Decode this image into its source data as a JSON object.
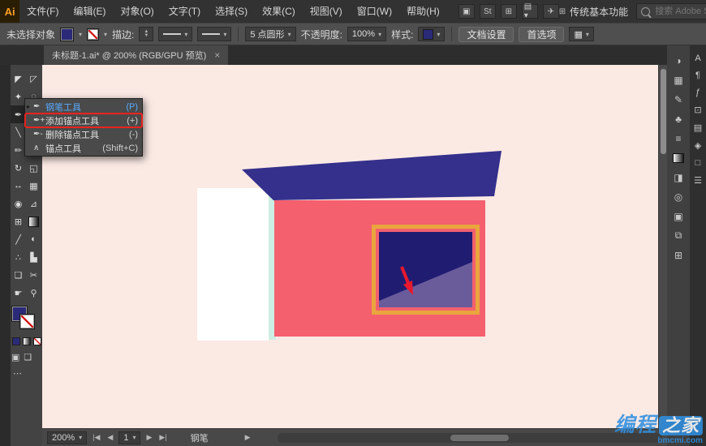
{
  "app": {
    "logo": "Ai"
  },
  "menubar": {
    "items": [
      {
        "name": "file",
        "label": "文件(F)"
      },
      {
        "name": "edit",
        "label": "编辑(E)"
      },
      {
        "name": "object",
        "label": "对象(O)"
      },
      {
        "name": "type",
        "label": "文字(T)"
      },
      {
        "name": "select",
        "label": "选择(S)"
      },
      {
        "name": "effect",
        "label": "效果(C)"
      },
      {
        "name": "view",
        "label": "视图(V)"
      },
      {
        "name": "window",
        "label": "窗口(W)"
      },
      {
        "name": "help",
        "label": "帮助(H)"
      }
    ],
    "icons": [
      {
        "name": "document-arrange-icon",
        "glyph": "▣"
      },
      {
        "name": "stock-icon",
        "glyph": "St"
      },
      {
        "name": "grid-view-icon",
        "glyph": "⊞"
      },
      {
        "name": "workspace-layout-icon",
        "glyph": "▤ ▾"
      },
      {
        "name": "share-icon",
        "glyph": "✈"
      }
    ],
    "workspace": "传统基本功能",
    "search_placeholder": "搜索 Adobe Stock"
  },
  "controlbar": {
    "selection_status": "未选择对象",
    "stroke_label": "描边:",
    "brush_name": "5 点圆形",
    "opacity_label": "不透明度:",
    "opacity_value": "100%",
    "style_label": "样式:",
    "doc_setup_label": "文档设置",
    "preferences_label": "首选项"
  },
  "tab": {
    "title": "未标题-1.ai* @ 200% (RGB/GPU 预览)",
    "close": "×"
  },
  "toolbar": {
    "tools": [
      {
        "name": "selection-tool",
        "glyph": "◤"
      },
      {
        "name": "direct-selection-tool",
        "glyph": "◸"
      },
      {
        "name": "magic-wand-tool",
        "glyph": "✦"
      },
      {
        "name": "lasso-tool",
        "glyph": "◌"
      },
      {
        "name": "pen-tool",
        "glyph": "✒",
        "active": true
      },
      {
        "name": "type-tool",
        "glyph": "T"
      },
      {
        "name": "line-segment-tool",
        "glyph": "╲"
      },
      {
        "name": "rectangle-tool",
        "glyph": "▭"
      },
      {
        "name": "paintbrush-tool",
        "glyph": "✏"
      },
      {
        "name": "pencil-tool",
        "glyph": "✎"
      },
      {
        "name": "rotate-tool",
        "glyph": "↻"
      },
      {
        "name": "scale-tool",
        "glyph": "◱"
      },
      {
        "name": "width-tool",
        "glyph": "↔"
      },
      {
        "name": "free-transform-tool",
        "glyph": "▦"
      },
      {
        "name": "shape-builder-tool",
        "glyph": "◉"
      },
      {
        "name": "perspective-grid-tool",
        "glyph": "⊿"
      },
      {
        "name": "mesh-tool",
        "glyph": "⊞"
      },
      {
        "name": "gradient-tool",
        "kind": "gradient"
      },
      {
        "name": "eyedropper-tool",
        "glyph": "╱"
      },
      {
        "name": "blend-tool",
        "glyph": "◐"
      },
      {
        "name": "symbol-sprayer-tool",
        "glyph": "∴"
      },
      {
        "name": "column-graph-tool",
        "glyph": "▙"
      },
      {
        "name": "artboard-tool",
        "glyph": "❏"
      },
      {
        "name": "slice-tool",
        "glyph": "✂"
      },
      {
        "name": "hand-tool",
        "glyph": "☛"
      },
      {
        "name": "zoom-tool",
        "glyph": "⚲"
      }
    ]
  },
  "flyout": {
    "items": [
      {
        "name": "pen-tool-menu-item",
        "icon": "pen-icon",
        "glyph": "✒",
        "label": "钢笔工具",
        "shortcut": "(P)",
        "state": "active"
      },
      {
        "name": "add-anchor-point-tool-menu-item",
        "icon": "add-anchor-pen-icon",
        "glyph": "✒+",
        "label": "添加锚点工具",
        "shortcut": "(+)",
        "state": "highlighted"
      },
      {
        "name": "delete-anchor-point-tool-menu-item",
        "icon": "delete-anchor-pen-icon",
        "glyph": "✒-",
        "label": "删除锚点工具",
        "shortcut": "(-)",
        "state": ""
      },
      {
        "name": "anchor-point-tool-menu-item",
        "icon": "anchor-point-icon",
        "glyph": "∧",
        "label": "锚点工具",
        "shortcut": "(Shift+C)",
        "state": ""
      }
    ]
  },
  "right_dock": {
    "primary": [
      {
        "name": "color-panel-icon",
        "glyph": "◑"
      },
      {
        "name": "swatches-panel-icon",
        "glyph": "▦"
      },
      {
        "name": "brushes-panel-icon",
        "glyph": "✎"
      },
      {
        "name": "symbols-panel-icon",
        "glyph": "♣"
      },
      {
        "name": "stroke-panel-icon",
        "glyph": "≡"
      },
      {
        "name": "gradient-panel-icon",
        "kind": "gradient"
      },
      {
        "name": "transparency-panel-icon",
        "glyph": "◨"
      },
      {
        "name": "appearance-panel-icon",
        "glyph": "◎"
      },
      {
        "name": "graphic-styles-panel-icon",
        "glyph": "▣"
      },
      {
        "name": "layers-panel-icon",
        "glyph": "⧉"
      },
      {
        "name": "artboards-panel-icon",
        "glyph": "⊞"
      }
    ],
    "secondary": [
      {
        "name": "character-panel-icon",
        "glyph": "A"
      },
      {
        "name": "paragraph-panel-icon",
        "glyph": "¶"
      },
      {
        "name": "opentype-panel-icon",
        "glyph": "ƒ"
      },
      {
        "name": "glyphs-panel-icon",
        "glyph": "⊡"
      },
      {
        "name": "align-panel-icon",
        "glyph": "▤"
      },
      {
        "name": "pathfinder-panel-icon",
        "glyph": "◈"
      },
      {
        "name": "transform-panel-icon",
        "glyph": "□"
      },
      {
        "name": "navigator-panel-icon",
        "glyph": "☰"
      }
    ]
  },
  "statusbar": {
    "zoom": "200%",
    "artboard_number": "1",
    "tool_name": "钢笔"
  },
  "artwork": {
    "colors": {
      "canvas_bg": "#fbe9e4",
      "wall_white": "#ffffff",
      "wall_shadow": "#cdeee3",
      "facade_pink": "#f4606e",
      "roof_navy": "#34308b",
      "window_frame_orange": "#eaa63e",
      "window_navy": "#201c72",
      "window_purple": "#6a5b9b",
      "arrow_red": "#e8192c"
    }
  },
  "watermark": {
    "big_left": "编程",
    "big_right": "之家",
    "small": "bmcmi.com"
  }
}
